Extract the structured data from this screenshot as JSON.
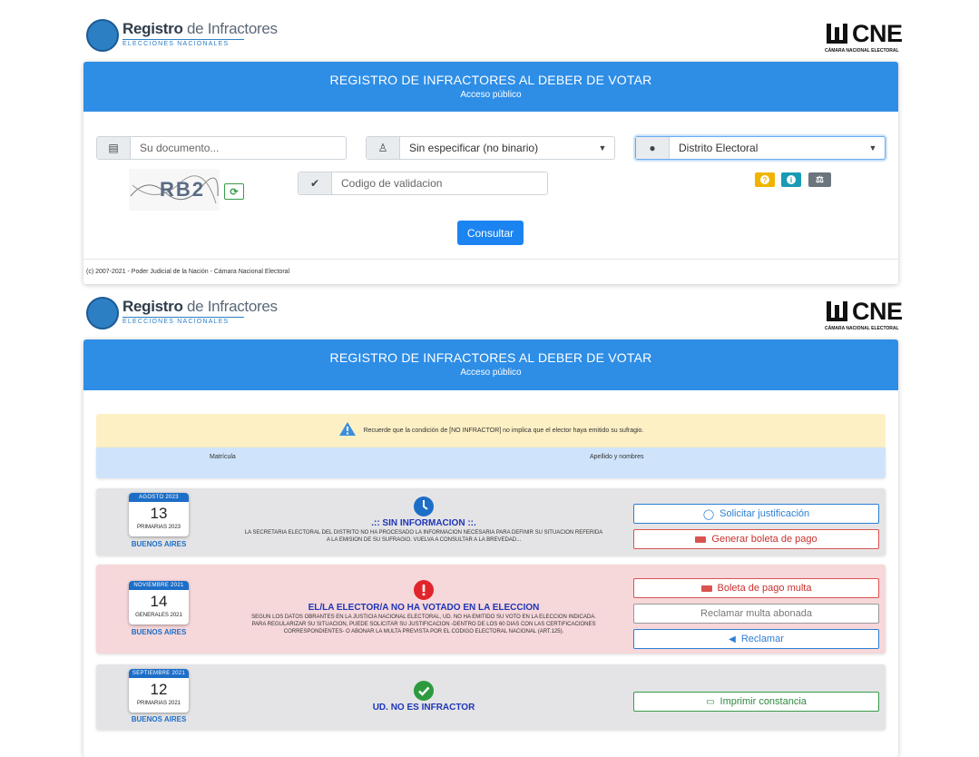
{
  "header": {
    "logo_bold": "Registro",
    "logo_light": " de Infractores",
    "logo_sub": "ELECCIONES NACIONALES",
    "cne_mark": "CNE",
    "cne_sub": "CÁMARA NACIONAL ELECTORAL"
  },
  "banner": {
    "title": "REGISTRO DE INFRACTORES AL DEBER DE VOTAR",
    "subtitle": "Acceso público"
  },
  "form": {
    "document_placeholder": "Su documento...",
    "gender_value": "Sin especificar (no binario)",
    "district_value": "Distrito Electoral",
    "captcha_text": "RB2",
    "validation_placeholder": "Codigo de validacion",
    "submit_label": "Consultar",
    "help_icon_text": "?",
    "info_icon_text": "i"
  },
  "footer": {
    "text": "(c) 2007-2021 - Poder Judicial de la Nación - Cámara Nacional Electoral"
  },
  "results": {
    "notice": "Recuerde que la condición de [NO INFRACTOR] no implica que el elector haya emitido su sufragio.",
    "col_matricula": "Matrícula",
    "col_apellido": "Apellido y nombres",
    "elections": [
      {
        "month": "AGOSTO 2023",
        "day": "13",
        "name": "PRIMARIAS 2023",
        "district": "BUENOS AIRES",
        "status_title": ".:: SIN INFORMACION ::.",
        "status_desc_1": "LA SECRETARIA ELECTORAL DEL DISTRITO NO HA PROCESADO LA INFORMACION NECESARIA PARA DEFINIR SU SITUACION REFERIDA",
        "status_desc_2": "A LA EMISION DE SU SUFRAGIO. VUELVA A CONSULTAR A LA BREVEDAD...",
        "btn_1": "Solicitar justificación",
        "btn_2": "Generar boleta de pago"
      },
      {
        "month": "NOVIEMBRE 2021",
        "day": "14",
        "name": "GENERALES 2021",
        "district": "BUENOS AIRES",
        "status_title": "EL/LA ELECTOR/A NO HA VOTADO EN LA ELECCION",
        "status_desc_1": "SEGUN LOS DATOS OBRANTES EN LA JUSTICIA NACIONAL ELECTORAL, UD. NO HA EMITIDO SU VOTO EN LA ELECCION INDICADA.",
        "status_desc_2": "PARA REGULARIZAR SU SITUACION, PUEDE SOLICITAR SU JUSTIFICACION -DENTRO DE LOS 60 DIAS CON LAS CERTIFICACIONES",
        "status_desc_3": "CORRESPONDIENTES- O ABONAR LA MULTA PREVISTA POR EL CODIGO ELECTORAL NACIONAL (ART.125).",
        "btn_1": "Boleta de pago multa",
        "btn_2": "Reclamar multa abonada",
        "btn_3": "Reclamar"
      },
      {
        "month": "SEPTIEMBRE 2021",
        "day": "12",
        "name": "PRIMARIAS 2021",
        "district": "BUENOS AIRES",
        "status_title": "UD. NO ES INFRACTOR",
        "btn_1": "Imprimir constancia"
      }
    ]
  },
  "colors": {
    "primary": "#2e8ee6",
    "warning_bg": "#fdf0c4",
    "info_bg": "#cfe4fb",
    "neutral_row": "#e4e4e6",
    "danger_row": "#f6d7da"
  }
}
